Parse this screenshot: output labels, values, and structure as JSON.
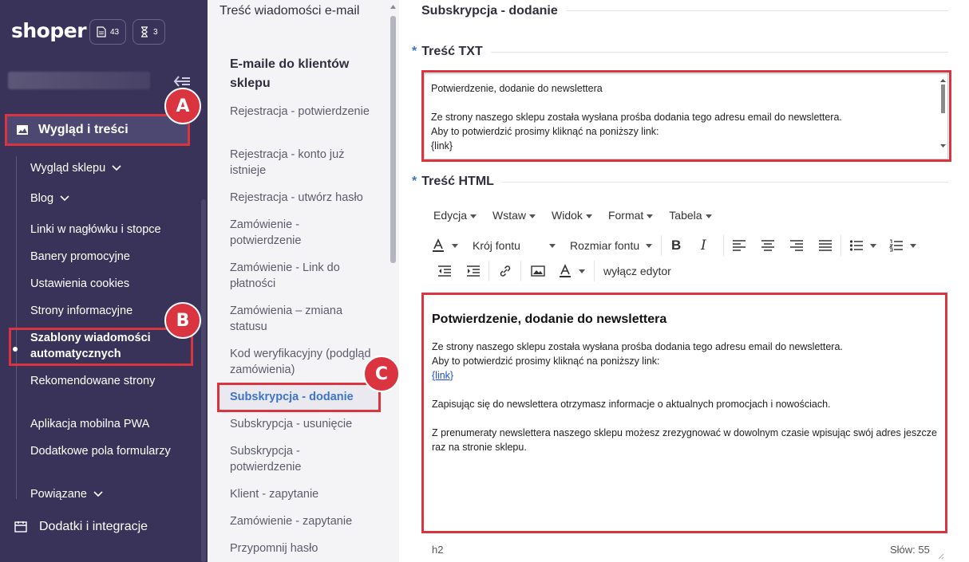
{
  "brand": {
    "logo": "shoper"
  },
  "badges": [
    {
      "icon": "document-icon",
      "count": "43"
    },
    {
      "icon": "hourglass-icon",
      "count": "3"
    }
  ],
  "sidebar": {
    "active_group": "Wygląd i treści",
    "items": [
      {
        "label": "Wygląd sklepu",
        "has_chevron": true
      },
      {
        "label": "Blog",
        "has_chevron": true
      },
      {
        "label": "Linki w nagłówku i stopce"
      },
      {
        "label": "Banery promocyjne"
      },
      {
        "label": "Ustawienia cookies"
      },
      {
        "label": "Strony informacyjne"
      },
      {
        "label": "Szablony wiadomości automatycznych",
        "active": true
      },
      {
        "label": "Rekomendowane strony"
      },
      {
        "label": "Aplikacja mobilna PWA"
      },
      {
        "label": "Dodatkowe pola formularzy"
      },
      {
        "label": "Powiązane",
        "has_chevron": true
      }
    ],
    "bottom_group": "Dodatki i integracje"
  },
  "middle": {
    "title": "Treść wiadomości e-mail",
    "subtitle": "E-maile do klientów sklepu",
    "items": [
      "Rejestracja - potwierdzenie",
      "Rejestracja - konto już istnieje",
      "Rejestracja - utwórz hasło",
      "Zamówienie - potwierdzenie",
      "Zamówienie - Link do płatności",
      "Zamówienia – zmiana statusu",
      "Kod weryfikacyjny (podgląd zamówienia)",
      "Subskrypcja - dodanie",
      "Subskrypcja - usunięcie",
      "Subskrypcja - potwierdzenie",
      "Klient - zapytanie",
      "Zamówienie - zapytanie",
      "Przypomnij hasło"
    ],
    "active_index": 7
  },
  "main": {
    "page_title": "Subskrypcja - dodanie",
    "required_mark": "*",
    "txt_label": "Treść TXT",
    "txt_lines": [
      "Potwierdzenie, dodanie do newslettera",
      "",
      "Ze strony naszego sklepu została wysłana prośba dodania tego adresu email do newslettera.",
      "Aby to potwierdzić prosimy kliknąć na poniższy link:",
      "{link}"
    ],
    "html_label": "Treść HTML",
    "menu": [
      "Edycja",
      "Wstaw",
      "Widok",
      "Format",
      "Tabela"
    ],
    "font_family_label": "Krój fontu",
    "font_size_label": "Rozmiar fontu",
    "disable_editor_label": "wyłącz edytor",
    "editor": {
      "heading": "Potwierdzenie, dodanie do newslettera",
      "p1_line1": "Ze strony naszego sklepu została wysłana prośba dodania tego adresu email do newslettera.",
      "p1_line2": "Aby to potwierdzić prosimy kliknąć na poniższy link:",
      "link": "{link}",
      "p2": "Zapisując się do newslettera otrzymasz informacje o aktualnych promocjach i nowościach.",
      "p3": "Z prenumeraty newslettera naszego sklepu możesz zrezygnować w dowolnym czasie wpisując swój adres jeszcze raz na stronie sklepu."
    },
    "status_element": "h2",
    "word_count": "Słów: 55"
  },
  "annotations": [
    "A",
    "B",
    "C"
  ],
  "colors": {
    "sidebar": "#39335a",
    "accent": "#3d74c9",
    "highlight": "#d9343f"
  }
}
